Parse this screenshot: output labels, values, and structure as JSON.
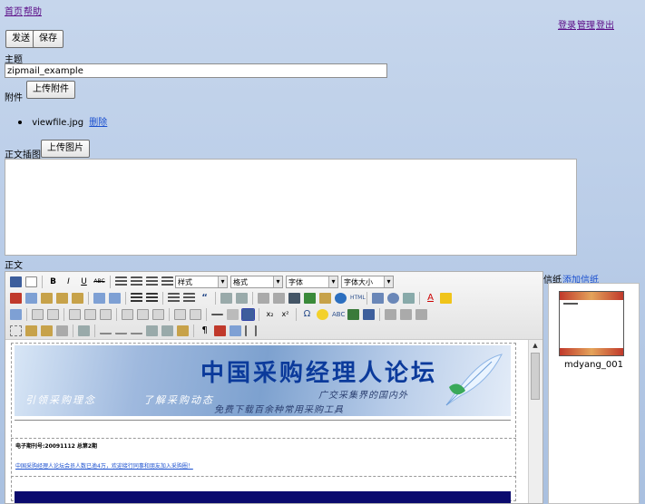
{
  "top_nav": {
    "home": "首页",
    "help": "帮助"
  },
  "user_nav": {
    "login": "登录",
    "manage": "管理",
    "logout": "登出"
  },
  "buttons": {
    "send": "发送",
    "save": "保存",
    "upload_attachment": "上传附件",
    "upload_image": "上传图片"
  },
  "subject": {
    "label": "主题",
    "value": "zipmail_example"
  },
  "attachments": {
    "label": "附件",
    "files": [
      {
        "name": "viewfile.jpg",
        "action": "删除"
      }
    ]
  },
  "inline_image": {
    "label": "正文插图"
  },
  "body_section": {
    "label": "正文"
  },
  "toolbar": {
    "combos": [
      "样式",
      "格式",
      "字体",
      "字体大小"
    ]
  },
  "document": {
    "banner_title": "中国采购经理人论坛",
    "banner_left": "引领采购理念　　　　了解采购动态",
    "banner_right": "广交采集界的国内外",
    "banner_bottom": "免费下载百余种常用采购工具",
    "issue_line": "电子期刊号:20091112 总第2期",
    "member_line": "中国采购经理人论坛会员人数已逾4万，欢迎接行同事和朋友加入采购圈！"
  },
  "stationery": {
    "label": "信纸",
    "add_link": "添加信纸",
    "items": [
      {
        "name": "mdyang_001"
      }
    ]
  }
}
